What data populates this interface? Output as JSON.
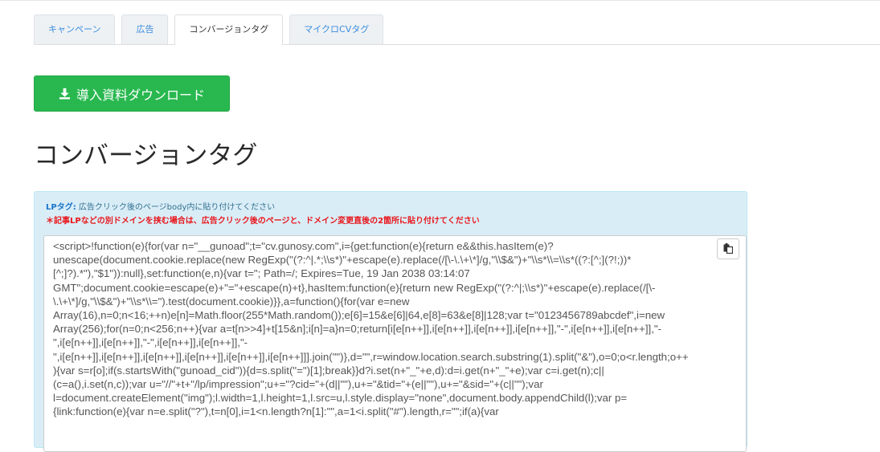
{
  "tabs": [
    {
      "label": "キャンペーン",
      "active": false
    },
    {
      "label": "広告",
      "active": false
    },
    {
      "label": "コンバージョンタグ",
      "active": true
    },
    {
      "label": "マイクロCVタグ",
      "active": false
    }
  ],
  "download_button": {
    "label": "導入資料ダウンロード",
    "icon": "download-icon",
    "color": "#28b84f"
  },
  "page_title": "コンバージョンタグ",
  "notice": {
    "lp_tag_label": "LPタグ:",
    "lp_tag_text": " 広告クリック後のページbody内に貼り付けてください",
    "warning": "＊記事LPなどの別ドメインを挟む場合は、広告クリック後のページと、ドメイン変更直後の2箇所に貼り付けてください"
  },
  "code": {
    "copy_icon": "clipboard-icon",
    "lines": [
      "            <script>!function(e){for(var n=\"__gunoad\";t=\"cv.gunosy.com\",i={get:function(e){return e&&this.hasItem(e)?",
      "unescape(document.cookie.replace(new RegExp(\"(?:^|.*;\\\\s*)\"+escape(e).replace(/[\\-\\.\\+\\*]/g,\"\\\\$&\")+\"\\\\s*\\\\=\\\\s*((?:[^;](?!;))*",
      "[^;]?).*\"),\"$1\")):null},set:function(e,n){var t=\"; Path=/; Expires=Tue, 19 Jan 2038 03:14:07",
      "GMT\";document.cookie=escape(e)+\"=\"+escape(n)+t},hasItem:function(e){return new RegExp(\"(?:^|;\\\\s*)\"+escape(e).replace(/[\\-",
      "\\.\\+\\*]/g,\"\\\\$&\")+\"\\\\s*\\\\=\").test(document.cookie)}},a=function(){for(var e=new",
      "Array(16),n=0;n<16;++n)e[n]=Math.floor(255*Math.random());e[6]=15&e[6]|64,e[8]=63&e[8]|128;var t=\"0123456789abcdef\",i=new",
      "Array(256);for(n=0;n<256;n++){var a=t[n>>4]+t[15&n];i[n]=a}n=0;return[i[e[n++]],i[e[n++]],i[e[n++]],i[e[n++]],\"-\",i[e[n++]],i[e[n++]],\"-",
      "\",i[e[n++]],i[e[n++]],\"-\",i[e[n++]],i[e[n++]],\"-",
      "\",i[e[n++]],i[e[n++]],i[e[n++]],i[e[n++]],i[e[n++]],i[e[n++]]].join(\"\")},d=\"\",r=window.location.search.substring(1).split(\"&\"),o=0;o<r.length;o++",
      "){var s=r[o];if(s.startsWith(\"gunoad_cid\")){d=s.split(\"=\")[1];break}}d?i.set(n+\"_\"+e,d):d=i.get(n+\"_\"+e);var c=i.get(n);c||",
      "(c=a(),i.set(n,c));var u=\"//\"+t+\"/lp/impression\";u+=\"?cid=\"+(d||\"\"),u+=\"&tid=\"+(e||\"\"),u+=\"&sid=\"+(c||\"\");var",
      "l=document.createElement(\"img\");l.width=1,l.height=1,l.src=u,l.style.display=\"none\",document.body.appendChild(l);var p=",
      "{link:function(e){var n=e.split(\"?\"),t=n[0],i=1<n.length?n[1]:\"\",a=1<i.split(\"#\").length,r=\"\";if(a){var"
    ]
  }
}
